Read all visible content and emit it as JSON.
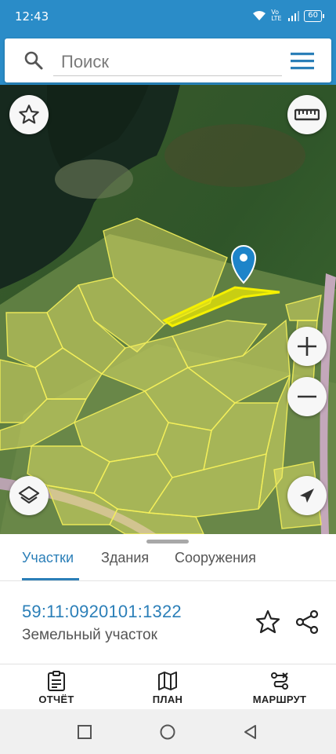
{
  "status_bar": {
    "time": "12:43",
    "network_label": "Vo LTE",
    "battery": "60"
  },
  "search": {
    "placeholder": "Поиск"
  },
  "tabs": [
    {
      "label": "Участки",
      "active": true
    },
    {
      "label": "Здания",
      "active": false
    },
    {
      "label": "Сооружения",
      "active": false
    }
  ],
  "parcel": {
    "cadastral_number": "59:11:0920101:1322",
    "type": "Земельный участок"
  },
  "bottom_nav": [
    {
      "label": "ОТЧЁТ",
      "icon": "report-icon"
    },
    {
      "label": "ПЛАН",
      "icon": "map-plan-icon"
    },
    {
      "label": "МАРШРУТ",
      "icon": "route-icon"
    }
  ],
  "colors": {
    "brand": "#2a8cc8",
    "accent_text": "#2b7fb8",
    "parcel_fill": "#f2ee6a",
    "selected_parcel": "#f5f000",
    "pin": "#1d84c9"
  }
}
